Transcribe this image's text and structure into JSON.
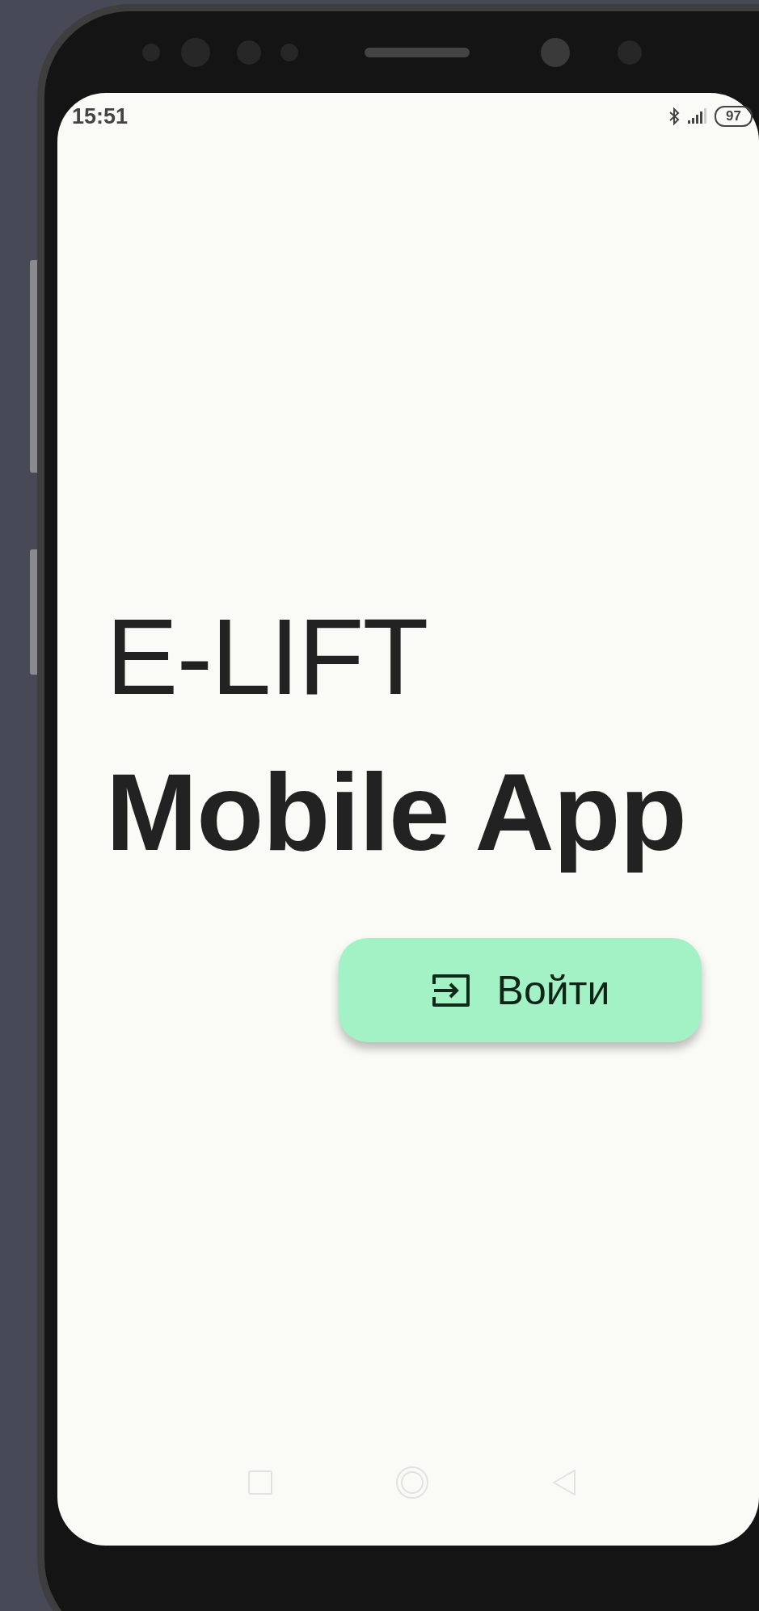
{
  "status_bar": {
    "time": "15:51",
    "battery": "97"
  },
  "title": "E-LIFT",
  "subtitle": "Mobile App",
  "login_button": {
    "label": "Войти"
  }
}
